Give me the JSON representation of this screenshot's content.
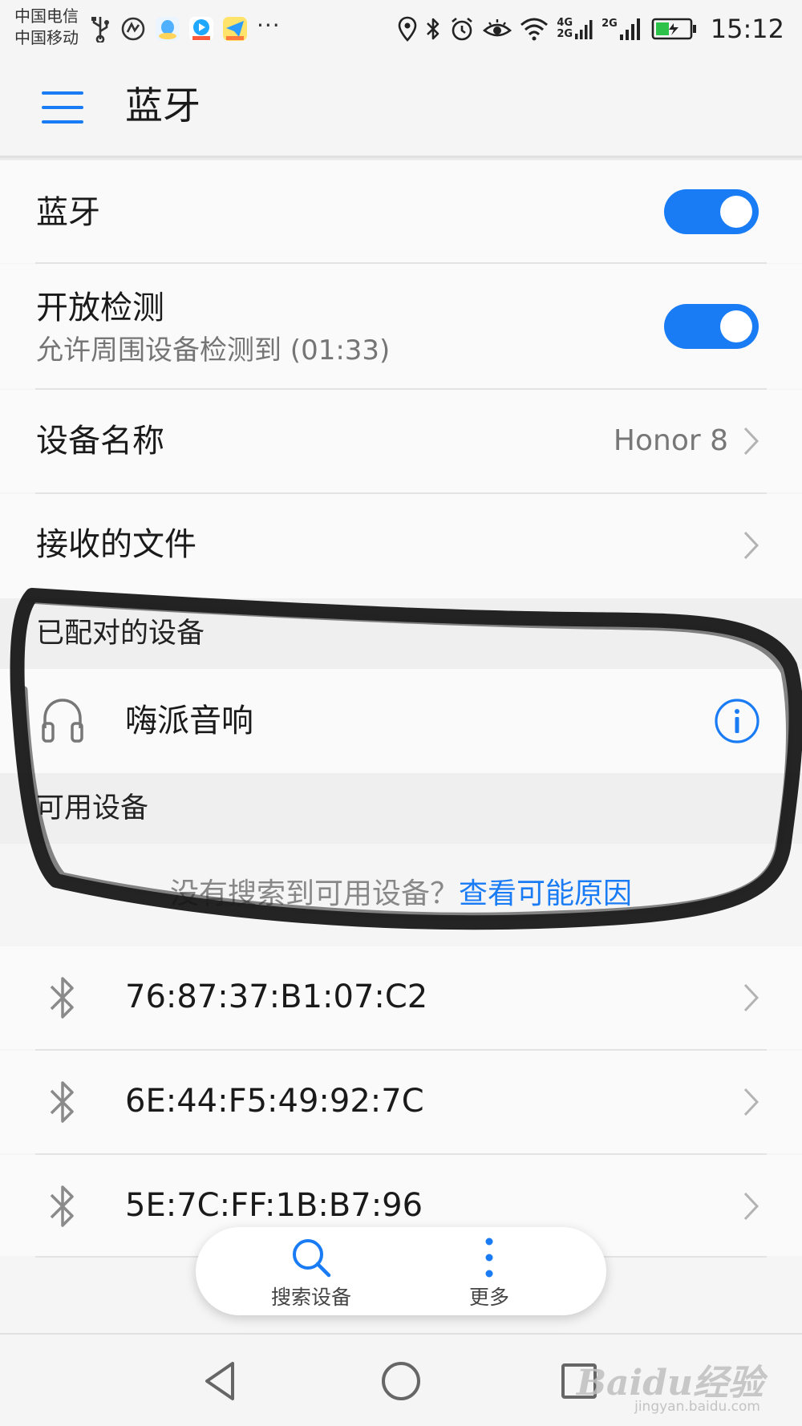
{
  "status_bar": {
    "carrier_1": "中国电信",
    "carrier_2": "中国移动",
    "net_1_top": "4G",
    "net_1_bottom": "2G",
    "net_2_top": "2G",
    "time": "15:12",
    "more": "···"
  },
  "app_bar": {
    "title": "蓝牙"
  },
  "settings": {
    "bluetooth": {
      "label": "蓝牙",
      "enabled": true
    },
    "visibility": {
      "label": "开放检测",
      "sublabel": "允许周围设备检测到 (01:33)",
      "enabled": true
    },
    "device_name": {
      "label": "设备名称",
      "value": "Honor 8"
    },
    "received_files": {
      "label": "接收的文件"
    }
  },
  "paired": {
    "header": "已配对的设备",
    "devices": [
      {
        "name": "嗨派音响",
        "icon": "headphones-icon"
      }
    ]
  },
  "available": {
    "header": "可用设备",
    "empty_hint": "没有搜索到可用设备？",
    "empty_link": "查看可能原因",
    "devices": [
      {
        "name": "76:87:37:B1:07:C2",
        "icon": "bluetooth-icon"
      },
      {
        "name": "6E:44:F5:49:92:7C",
        "icon": "bluetooth-icon"
      },
      {
        "name": "5E:7C:FF:1B:B7:96",
        "icon": "bluetooth-icon"
      }
    ]
  },
  "actions": {
    "search": "搜索设备",
    "more": "更多"
  },
  "watermark": {
    "brand": "Baidu经验",
    "url": "jingyan.baidu.com"
  },
  "colors": {
    "accent": "#1a7cf5",
    "background": "#f5f5f5",
    "section_header": "#efefef"
  }
}
